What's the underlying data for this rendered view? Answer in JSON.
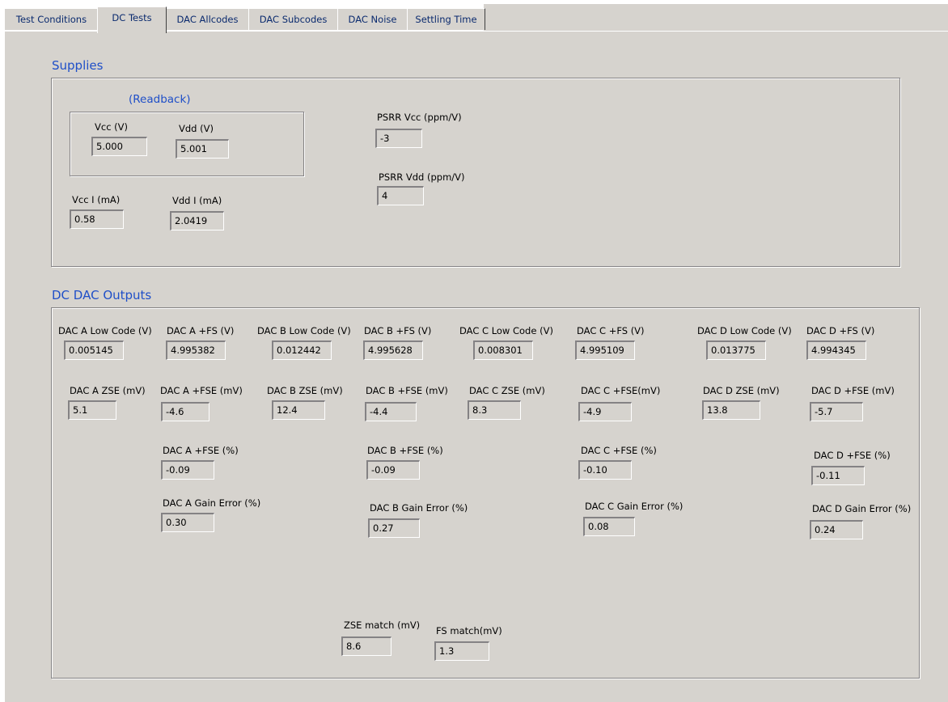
{
  "tabs": [
    {
      "label": "Test Conditions",
      "active": false
    },
    {
      "label": "DC Tests",
      "active": true
    },
    {
      "label": "DAC Allcodes",
      "active": false
    },
    {
      "label": "DAC Subcodes",
      "active": false
    },
    {
      "label": "DAC Noise",
      "active": false
    },
    {
      "label": "Settling Time",
      "active": false
    }
  ],
  "supplies": {
    "title": "Supplies",
    "readback_label": "(Readback)",
    "vcc_v": {
      "label": "Vcc (V)",
      "value": "5.000"
    },
    "vdd_v": {
      "label": "Vdd (V)",
      "value": "5.001"
    },
    "vcc_i": {
      "label": "Vcc I (mA)",
      "value": "0.58"
    },
    "vdd_i": {
      "label": "Vdd I (mA)",
      "value": "2.0419"
    },
    "psrr_vcc": {
      "label": "PSRR Vcc (ppm/V)",
      "value": "-3"
    },
    "psrr_vdd": {
      "label": "PSRR Vdd (ppm/V)",
      "value": "4"
    }
  },
  "dc_outputs": {
    "title": "DC DAC Outputs",
    "a_low": {
      "label": "DAC A Low Code (V)",
      "value": "0.005145"
    },
    "a_fs": {
      "label": "DAC A +FS (V)",
      "value": "4.995382"
    },
    "b_low": {
      "label": "DAC B Low Code (V)",
      "value": "0.012442"
    },
    "b_fs": {
      "label": "DAC B +FS (V)",
      "value": "4.995628"
    },
    "c_low": {
      "label": "DAC C Low Code (V)",
      "value": "0.008301"
    },
    "c_fs": {
      "label": "DAC C +FS (V)",
      "value": "4.995109"
    },
    "d_low": {
      "label": "DAC D Low Code (V)",
      "value": "0.013775"
    },
    "d_fs": {
      "label": "DAC D +FS (V)",
      "value": "4.994345"
    },
    "a_zse": {
      "label": "DAC A ZSE (mV)",
      "value": "5.1"
    },
    "a_fse": {
      "label": "DAC A +FSE (mV)",
      "value": "-4.6"
    },
    "b_zse": {
      "label": "DAC B ZSE (mV)",
      "value": "12.4"
    },
    "b_fse": {
      "label": "DAC B +FSE (mV)",
      "value": "-4.4"
    },
    "c_zse": {
      "label": "DAC C ZSE (mV)",
      "value": "8.3"
    },
    "c_fse": {
      "label": "DAC C +FSE(mV)",
      "value": "-4.9"
    },
    "d_zse": {
      "label": "DAC D ZSE (mV)",
      "value": "13.8"
    },
    "d_fse": {
      "label": "DAC D +FSE (mV)",
      "value": "-5.7"
    },
    "a_fse_pct": {
      "label": "DAC A +FSE (%)",
      "value": "-0.09"
    },
    "b_fse_pct": {
      "label": "DAC B +FSE (%)",
      "value": "-0.09"
    },
    "c_fse_pct": {
      "label": "DAC C  +FSE (%)",
      "value": "-0.10"
    },
    "d_fse_pct": {
      "label": "DAC D +FSE (%)",
      "value": "-0.11"
    },
    "a_gain": {
      "label": "DAC A Gain Error (%)",
      "value": "0.30"
    },
    "b_gain": {
      "label": "DAC B Gain Error (%)",
      "value": "0.27"
    },
    "c_gain": {
      "label": "DAC C Gain Error (%)",
      "value": "0.08"
    },
    "d_gain": {
      "label": "DAC D Gain Error (%)",
      "value": "0.24"
    },
    "zse_match": {
      "label": "ZSE match (mV)",
      "value": "8.6"
    },
    "fs_match": {
      "label": "FS match(mV)",
      "value": "1.3"
    }
  }
}
